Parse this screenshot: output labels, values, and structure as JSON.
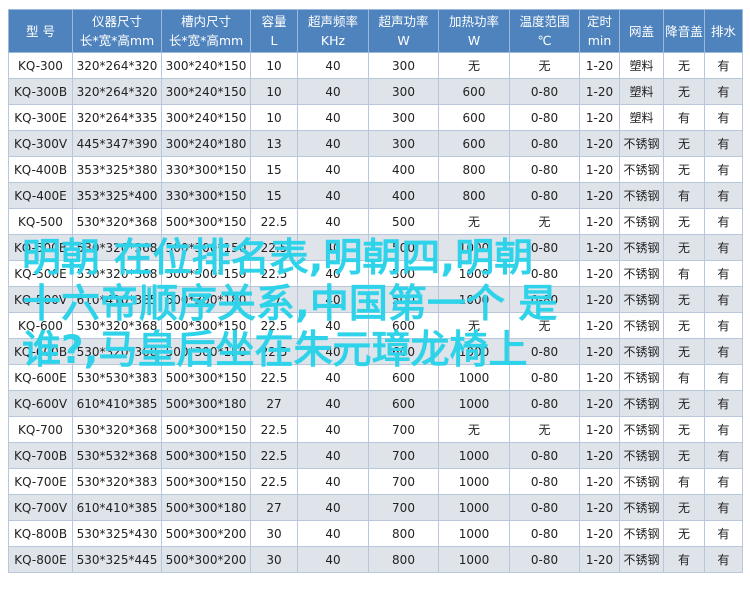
{
  "headers": [
    [
      "型 号"
    ],
    [
      "仪器尺寸",
      "长*宽*高mm"
    ],
    [
      "槽内尺寸",
      "长*宽*高mm"
    ],
    [
      "容量",
      "L"
    ],
    [
      "超声频率",
      "KHz"
    ],
    [
      "超声功率",
      "W"
    ],
    [
      "加热功率",
      "W"
    ],
    [
      "温度范围",
      "℃"
    ],
    [
      "定时",
      "min"
    ],
    [
      "网盖"
    ],
    [
      "降音盖"
    ],
    [
      "排水"
    ]
  ],
  "rows": [
    [
      "KQ-300",
      "320*264*320",
      "300*240*150",
      "10",
      "40",
      "300",
      "无",
      "无",
      "1-20",
      "塑料",
      "无",
      "有"
    ],
    [
      "KQ-300B",
      "320*264*320",
      "300*240*150",
      "10",
      "40",
      "300",
      "600",
      "0-80",
      "1-20",
      "塑料",
      "无",
      "有"
    ],
    [
      "KQ-300E",
      "320*264*335",
      "300*240*150",
      "10",
      "40",
      "300",
      "600",
      "0-80",
      "1-20",
      "塑料",
      "有",
      "有"
    ],
    [
      "KQ-300V",
      "445*347*390",
      "300*240*180",
      "13",
      "40",
      "300",
      "600",
      "0-80",
      "1-20",
      "不锈钢",
      "无",
      "有"
    ],
    [
      "KQ-400B",
      "353*325*380",
      "330*300*150",
      "15",
      "40",
      "400",
      "800",
      "0-80",
      "1-20",
      "不锈钢",
      "无",
      "有"
    ],
    [
      "KQ-400E",
      "353*325*400",
      "330*300*150",
      "15",
      "40",
      "400",
      "800",
      "0-80",
      "1-20",
      "不锈钢",
      "有",
      "有"
    ],
    [
      "KQ-500",
      "530*320*368",
      "500*300*150",
      "22.5",
      "40",
      "500",
      "无",
      "无",
      "1-20",
      "不锈钢",
      "无",
      "有"
    ],
    [
      "KQ-500B",
      "530*320*368",
      "500*300*150",
      "22.5",
      "40",
      "500",
      "1000",
      "0-80",
      "1-20",
      "不锈钢",
      "无",
      "有"
    ],
    [
      "KQ-500E",
      "530*320*368",
      "500*300*150",
      "22.5",
      "40",
      "500",
      "1000",
      "0-80",
      "1-20",
      "不锈钢",
      "有",
      "有"
    ],
    [
      "KQ-500V",
      "610*410*385",
      "500*300*180",
      "27",
      "40",
      "500",
      "1000",
      "0-80",
      "1-20",
      "不锈钢",
      "无",
      "有"
    ],
    [
      "KQ-600",
      "530*320*368",
      "500*300*150",
      "22.5",
      "40",
      "600",
      "无",
      "无",
      "1-20",
      "不锈钢",
      "无",
      "有"
    ],
    [
      "KQ-600B",
      "530*320*368",
      "500*300*150",
      "22.5",
      "40",
      "600",
      "1000",
      "0-80",
      "1-20",
      "不锈钢",
      "无",
      "有"
    ],
    [
      "KQ-600E",
      "530*530*383",
      "500*300*150",
      "22.5",
      "40",
      "600",
      "1000",
      "0-80",
      "1-20",
      "不锈钢",
      "有",
      "有"
    ],
    [
      "KQ-600V",
      "610*410*385",
      "500*300*180",
      "27",
      "40",
      "600",
      "1000",
      "0-80",
      "1-20",
      "不锈钢",
      "无",
      "有"
    ],
    [
      "KQ-700",
      "530*320*368",
      "500*300*150",
      "22.5",
      "40",
      "700",
      "无",
      "无",
      "1-20",
      "不锈钢",
      "无",
      "有"
    ],
    [
      "KQ-700B",
      "530*532*368",
      "500*300*150",
      "22.5",
      "40",
      "700",
      "1000",
      "0-80",
      "1-20",
      "不锈钢",
      "无",
      "有"
    ],
    [
      "KQ-700E",
      "530*320*383",
      "500*300*150",
      "22.5",
      "40",
      "700",
      "1000",
      "0-80",
      "1-20",
      "不锈钢",
      "有",
      "有"
    ],
    [
      "KQ-700V",
      "610*410*385",
      "500*300*180",
      "27",
      "40",
      "700",
      "1000",
      "0-80",
      "1-20",
      "不锈钢",
      "无",
      "有"
    ],
    [
      "KQ-800B",
      "530*325*430",
      "500*300*200",
      "30",
      "40",
      "800",
      "1000",
      "0-80",
      "1-20",
      "不锈钢",
      "无",
      "有"
    ],
    [
      "KQ-800E",
      "530*325*445",
      "500*300*200",
      "30",
      "40",
      "800",
      "1000",
      "0-80",
      "1-20",
      "不锈钢",
      "有",
      "有"
    ]
  ],
  "overlay_lines": [
    "明朝 在位排名表,明朝四,明朝",
    "十六帝顺序关系,中国第一个 是",
    "谁?,马皇后坐在朱元璋龙椅上"
  ]
}
